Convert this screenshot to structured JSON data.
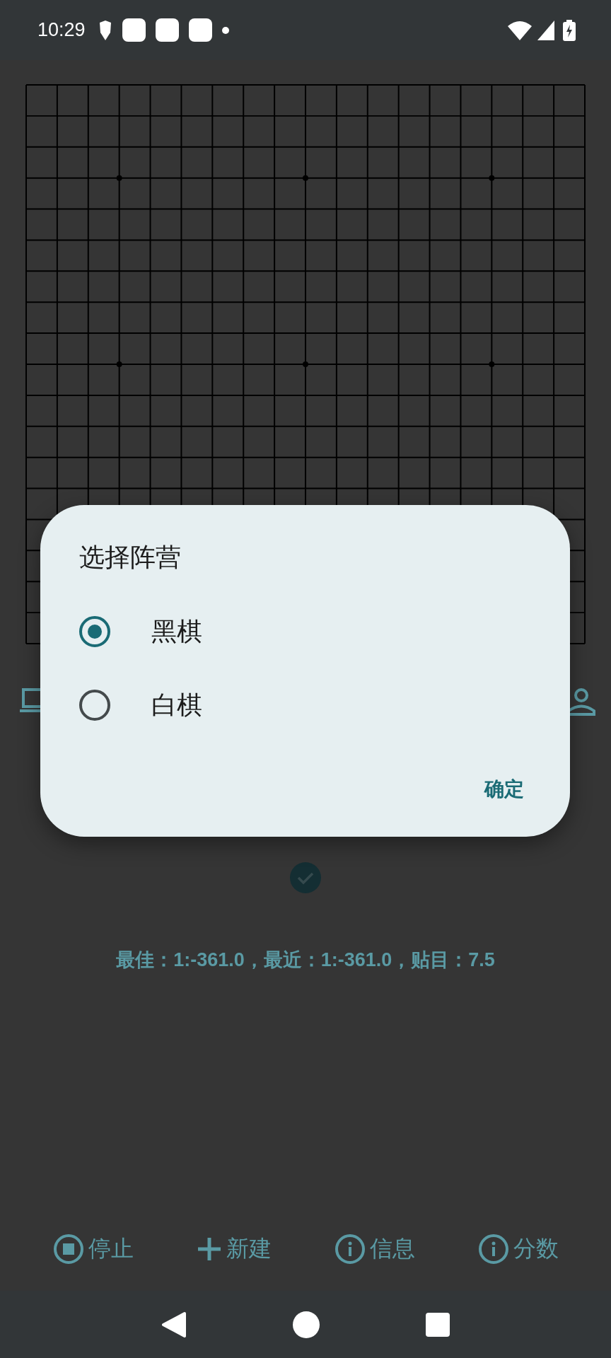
{
  "status_bar": {
    "time": "10:29"
  },
  "score_text": "最佳：1:-361.0，最近：1:-361.0，贴目：7.5",
  "toolbar": [
    {
      "kind": "stop",
      "label": "停止"
    },
    {
      "kind": "new",
      "label": "新建"
    },
    {
      "kind": "info",
      "label": "信息"
    },
    {
      "kind": "info",
      "label": "分数"
    }
  ],
  "dialog": {
    "title": "选择阵营",
    "options": [
      {
        "label": "黑棋",
        "selected": true
      },
      {
        "label": "白棋",
        "selected": false
      }
    ],
    "confirm": "确定"
  }
}
